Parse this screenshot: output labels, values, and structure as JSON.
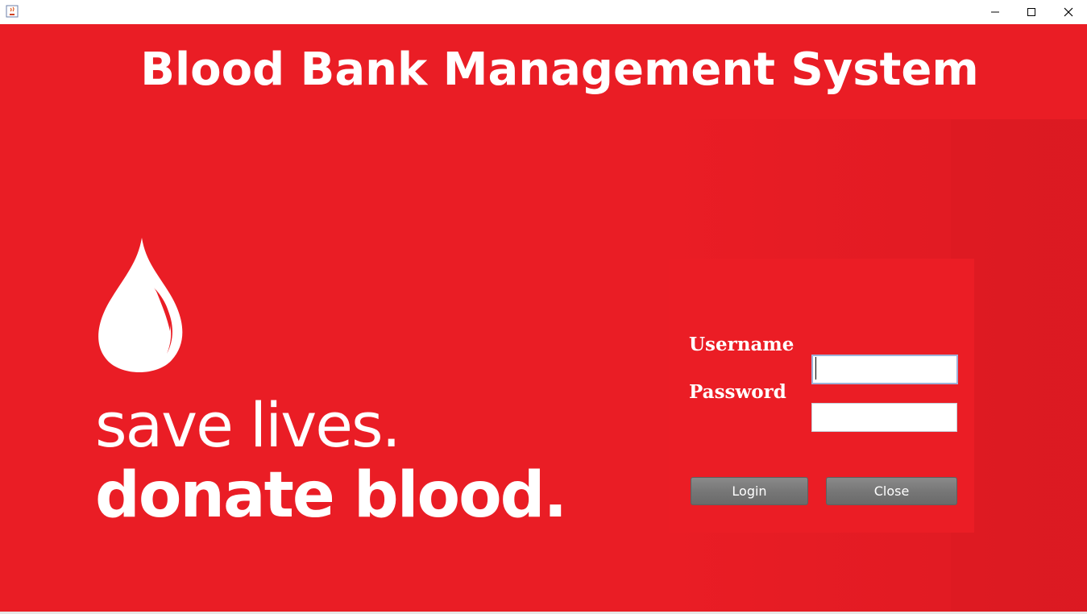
{
  "window": {
    "app_icon": "java-icon",
    "controls": [
      "minimize-icon",
      "maximize-icon",
      "close-icon"
    ]
  },
  "header": {
    "title": "Blood Bank Management System"
  },
  "hero": {
    "logo_icon": "blood-drop-icon",
    "slogan_line1": "save lives.",
    "slogan_line2": "donate blood."
  },
  "login": {
    "username_label": "Username",
    "password_label": "Password",
    "username_value": "",
    "password_value": "",
    "login_button": "Login",
    "close_button": "Close"
  },
  "colors": {
    "background": "#ea1d25",
    "text": "#ffffff",
    "button": "#777777"
  }
}
